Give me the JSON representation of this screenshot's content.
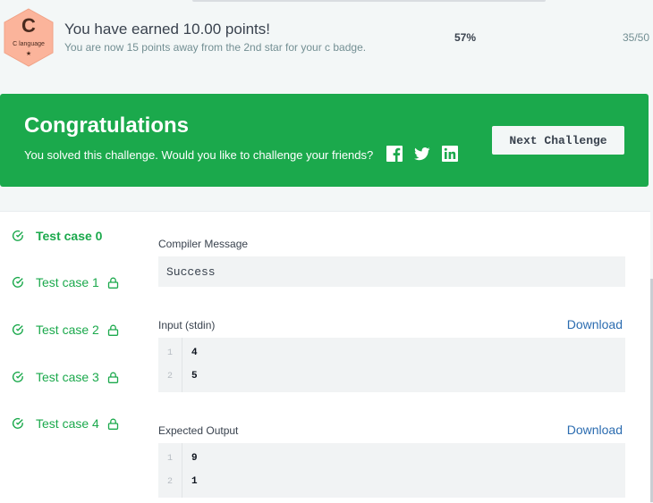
{
  "badge": {
    "letter": "C",
    "language": "C language",
    "star": "★",
    "color": "#fbb49b"
  },
  "earned": {
    "title": "You have earned 10.00 points!",
    "subtitle": "You are now 15 points away from the 2nd star for your c badge.",
    "progress_percent": "57%",
    "progress_count": "35/50"
  },
  "congrats": {
    "title": "Congratulations",
    "subtitle": "You solved this challenge. Would you like to challenge your friends?",
    "share_icons": [
      "facebook-icon",
      "twitter-icon",
      "linkedin-icon"
    ],
    "next_button": "Next Challenge",
    "background": "#1ba94c"
  },
  "test_cases": [
    {
      "label": "Test case 0",
      "status": "passed",
      "locked": false,
      "active": true
    },
    {
      "label": "Test case 1",
      "status": "passed",
      "locked": true,
      "active": false
    },
    {
      "label": "Test case 2",
      "status": "passed",
      "locked": true,
      "active": false
    },
    {
      "label": "Test case 3",
      "status": "passed",
      "locked": true,
      "active": false
    },
    {
      "label": "Test case 4",
      "status": "passed",
      "locked": true,
      "active": false
    }
  ],
  "compiler": {
    "label": "Compiler Message",
    "message": "Success"
  },
  "input": {
    "label": "Input (stdin)",
    "download": "Download",
    "lines": [
      {
        "n": "1",
        "text": "4"
      },
      {
        "n": "2",
        "text": "5"
      }
    ]
  },
  "expected": {
    "label": "Expected Output",
    "download": "Download",
    "lines": [
      {
        "n": "1",
        "text": "9"
      },
      {
        "n": "2",
        "text": "1"
      }
    ]
  }
}
